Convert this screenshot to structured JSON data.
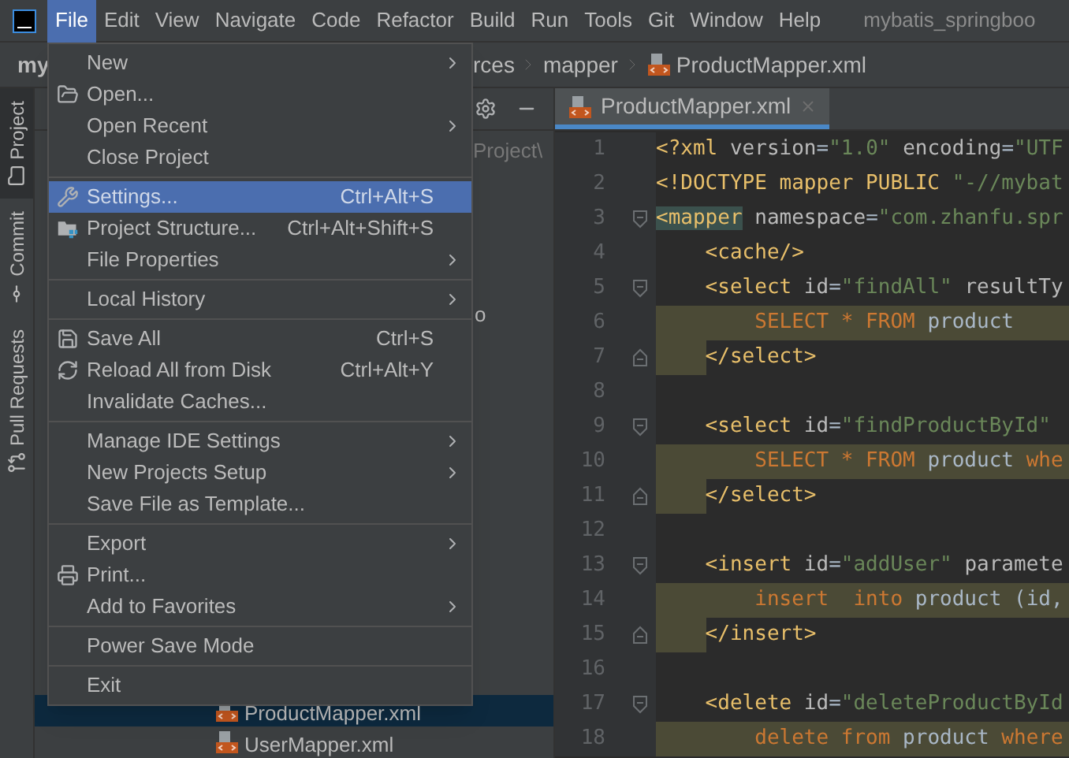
{
  "menu_bar": {
    "items": [
      {
        "label": "File",
        "selected": true
      },
      {
        "label": "Edit",
        "selected": false
      },
      {
        "label": "View",
        "selected": false
      },
      {
        "label": "Navigate",
        "selected": false
      },
      {
        "label": "Code",
        "selected": false
      },
      {
        "label": "Refactor",
        "selected": false
      },
      {
        "label": "Build",
        "selected": false
      },
      {
        "label": "Run",
        "selected": false
      },
      {
        "label": "Tools",
        "selected": false
      },
      {
        "label": "Git",
        "selected": false
      },
      {
        "label": "Window",
        "selected": false
      },
      {
        "label": "Help",
        "selected": false
      }
    ],
    "window_title": "mybatis_springboo"
  },
  "navigation_bar": {
    "project": "my",
    "crumbs": [
      "rces",
      "mapper",
      "ProductMapper.xml"
    ]
  },
  "tool_strip": [
    {
      "label": "Project",
      "selected": true
    },
    {
      "label": "Commit",
      "selected": false
    },
    {
      "label": "Pull Requests",
      "selected": false
    }
  ],
  "project_panel": {
    "path_fragment": "Project\\",
    "fragment": "o",
    "rows": [
      {
        "label": "ProductMapper.xml",
        "selected": true
      },
      {
        "label": "UserMapper.xml",
        "selected": false
      }
    ]
  },
  "file_menu": {
    "groups": [
      [
        {
          "label": "New",
          "submenu": true,
          "selected": false
        },
        {
          "label": "Open...",
          "submenu": false,
          "selected": false
        },
        {
          "label": "Open Recent",
          "submenu": true,
          "selected": false
        },
        {
          "label": "Close Project",
          "submenu": false,
          "selected": false
        }
      ],
      [
        {
          "label": "Settings...",
          "shortcut": "Ctrl+Alt+S",
          "submenu": false,
          "selected": true
        },
        {
          "label": "Project Structure...",
          "shortcut": "Ctrl+Alt+Shift+S",
          "submenu": false,
          "selected": false
        },
        {
          "label": "File Properties",
          "submenu": true,
          "selected": false
        }
      ],
      [
        {
          "label": "Local History",
          "submenu": true,
          "selected": false
        }
      ],
      [
        {
          "label": "Save All",
          "shortcut": "Ctrl+S",
          "submenu": false,
          "selected": false
        },
        {
          "label": "Reload All from Disk",
          "shortcut": "Ctrl+Alt+Y",
          "submenu": false,
          "selected": false
        },
        {
          "label": "Invalidate Caches...",
          "submenu": false,
          "selected": false
        }
      ],
      [
        {
          "label": "Manage IDE Settings",
          "submenu": true,
          "selected": false
        },
        {
          "label": "New Projects Setup",
          "submenu": true,
          "selected": false
        },
        {
          "label": "Save File as Template...",
          "submenu": false,
          "selected": false
        }
      ],
      [
        {
          "label": "Export",
          "submenu": true,
          "selected": false
        },
        {
          "label": "Print...",
          "submenu": false,
          "selected": false
        },
        {
          "label": "Add to Favorites",
          "submenu": true,
          "selected": false
        }
      ],
      [
        {
          "label": "Power Save Mode",
          "submenu": false,
          "selected": false
        }
      ],
      [
        {
          "label": "Exit",
          "submenu": false,
          "selected": false
        }
      ]
    ]
  },
  "editor": {
    "tabs": [
      {
        "label": "ProductMapper.xml",
        "selected": true
      }
    ],
    "lines": [
      {
        "number": "1",
        "kind": "plain",
        "fold_start": false,
        "fold_end": false,
        "tokens": [
          {
            "text": "<?xml ",
            "kind": "tag"
          },
          {
            "text": "version",
            "kind": "attr"
          },
          {
            "text": "=",
            "kind": "text"
          },
          {
            "text": "\"1.0\" ",
            "kind": "value"
          },
          {
            "text": "encoding",
            "kind": "attr"
          },
          {
            "text": "=",
            "kind": "text"
          },
          {
            "text": "\"UTF",
            "kind": "value"
          }
        ]
      },
      {
        "number": "2",
        "kind": "plain",
        "fold_start": false,
        "fold_end": false,
        "tokens": [
          {
            "text": "<!DOCTYPE mapper PUBLIC ",
            "kind": "tag"
          },
          {
            "text": "\"-//mybat",
            "kind": "value"
          }
        ]
      },
      {
        "number": "3",
        "kind": "plain",
        "fold_start": true,
        "fold_end": false,
        "tokens": [
          {
            "text": "<mapper",
            "kind": "matched_tag"
          },
          {
            "text": " namespace",
            "kind": "attr"
          },
          {
            "text": "=",
            "kind": "text"
          },
          {
            "text": "\"com.zhanfu.spr",
            "kind": "value"
          }
        ]
      },
      {
        "number": "4",
        "kind": "plain",
        "fold_start": false,
        "fold_end": false,
        "tokens": [
          {
            "text": "    <cache/>",
            "kind": "tag"
          }
        ]
      },
      {
        "number": "5",
        "kind": "plain",
        "fold_start": true,
        "fold_end": false,
        "tokens": [
          {
            "text": "    <select ",
            "kind": "tag"
          },
          {
            "text": "id",
            "kind": "attr"
          },
          {
            "text": "=",
            "kind": "text"
          },
          {
            "text": "\"findAll\" ",
            "kind": "value"
          },
          {
            "text": "resultTy",
            "kind": "attr"
          }
        ]
      },
      {
        "number": "6",
        "kind": "sql",
        "fold_start": false,
        "fold_end": false,
        "tokens": [
          {
            "text": "        SELECT * FROM ",
            "kind": "keyword"
          },
          {
            "text": "product",
            "kind": "text"
          }
        ]
      },
      {
        "number": "7",
        "kind": "sql_close",
        "fold_start": false,
        "fold_end": true,
        "tokens": [
          {
            "text": "    </select>",
            "kind": "tag"
          }
        ]
      },
      {
        "number": "8",
        "kind": "plain",
        "fold_start": false,
        "fold_end": false
      },
      {
        "number": "9",
        "kind": "plain",
        "fold_start": true,
        "fold_end": false,
        "tokens": [
          {
            "text": "    <select ",
            "kind": "tag"
          },
          {
            "text": "id",
            "kind": "attr"
          },
          {
            "text": "=",
            "kind": "text"
          },
          {
            "text": "\"findProductById\"",
            "kind": "value"
          }
        ]
      },
      {
        "number": "10",
        "kind": "sql",
        "fold_start": false,
        "fold_end": false,
        "tokens": [
          {
            "text": "        SELECT * FROM ",
            "kind": "keyword"
          },
          {
            "text": "product ",
            "kind": "text"
          },
          {
            "text": "whe",
            "kind": "keyword"
          }
        ]
      },
      {
        "number": "11",
        "kind": "sql_close",
        "fold_start": false,
        "fold_end": true,
        "tokens": [
          {
            "text": "    </select>",
            "kind": "tag"
          }
        ]
      },
      {
        "number": "12",
        "kind": "plain",
        "fold_start": false,
        "fold_end": false
      },
      {
        "number": "13",
        "kind": "plain",
        "fold_start": true,
        "fold_end": false,
        "tokens": [
          {
            "text": "    <insert ",
            "kind": "tag"
          },
          {
            "text": "id",
            "kind": "attr"
          },
          {
            "text": "=",
            "kind": "text"
          },
          {
            "text": "\"addUser\" ",
            "kind": "value"
          },
          {
            "text": "paramete",
            "kind": "attr"
          }
        ]
      },
      {
        "number": "14",
        "kind": "sql",
        "fold_start": false,
        "fold_end": false,
        "tokens": [
          {
            "text": "        insert  into ",
            "kind": "keyword"
          },
          {
            "text": "product (id,",
            "kind": "text"
          }
        ]
      },
      {
        "number": "15",
        "kind": "sql_close",
        "fold_start": false,
        "fold_end": true,
        "tokens": [
          {
            "text": "    </insert>",
            "kind": "tag"
          }
        ]
      },
      {
        "number": "16",
        "kind": "plain",
        "fold_start": false,
        "fold_end": false
      },
      {
        "number": "17",
        "kind": "plain",
        "fold_start": true,
        "fold_end": false,
        "tokens": [
          {
            "text": "    <delete ",
            "kind": "tag"
          },
          {
            "text": "id",
            "kind": "attr"
          },
          {
            "text": "=",
            "kind": "text"
          },
          {
            "text": "\"deleteProductById",
            "kind": "value"
          }
        ]
      },
      {
        "number": "18",
        "kind": "sql",
        "fold_start": false,
        "fold_end": false,
        "tokens": [
          {
            "text": "        delete from ",
            "kind": "keyword"
          },
          {
            "text": "product ",
            "kind": "text"
          },
          {
            "text": "where",
            "kind": "keyword"
          }
        ]
      }
    ]
  }
}
